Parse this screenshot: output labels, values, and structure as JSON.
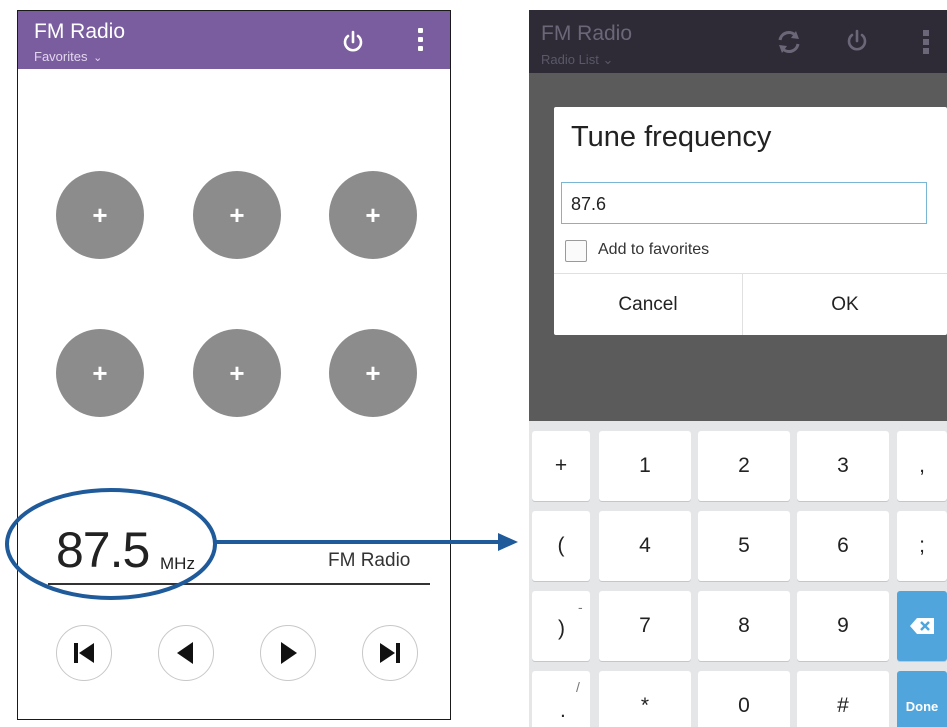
{
  "left_screen": {
    "app_title": "FM Radio",
    "subtitle": "Favorites",
    "presets": [
      "+",
      "+",
      "+",
      "+",
      "+",
      "+"
    ],
    "frequency": "87.5",
    "unit": "MHz",
    "station_label": "FM Radio"
  },
  "right_screen": {
    "app_title": "FM Radio",
    "subtitle": "Radio List",
    "dialog": {
      "title": "Tune frequency",
      "input_value": "87.6",
      "checkbox_label": "Add to favorites",
      "cancel_label": "Cancel",
      "ok_label": "OK"
    },
    "keyboard": {
      "row1": [
        "+",
        "1",
        "2",
        "3",
        ","
      ],
      "row2": [
        "(",
        "4",
        "5",
        "6",
        ";"
      ],
      "row3": [
        ")",
        "7",
        "8",
        "9"
      ],
      "row3_hint": "-",
      "row4": [
        ".",
        "*",
        "0",
        "#"
      ],
      "row4_hint": "/",
      "done_label": "Done"
    }
  },
  "colors": {
    "appbar_purple": "#7a5d9e",
    "dim_appbar": "#2e2b36",
    "preset_gray": "#8c8c8c",
    "annotation_blue": "#1f5a9a",
    "key_blue": "#4fa5dc"
  },
  "icons": [
    "power-icon",
    "overflow-menu-icon",
    "refresh-icon",
    "skip-previous-icon",
    "previous-icon",
    "next-icon",
    "skip-next-icon",
    "backspace-icon",
    "chevron-down-icon"
  ]
}
